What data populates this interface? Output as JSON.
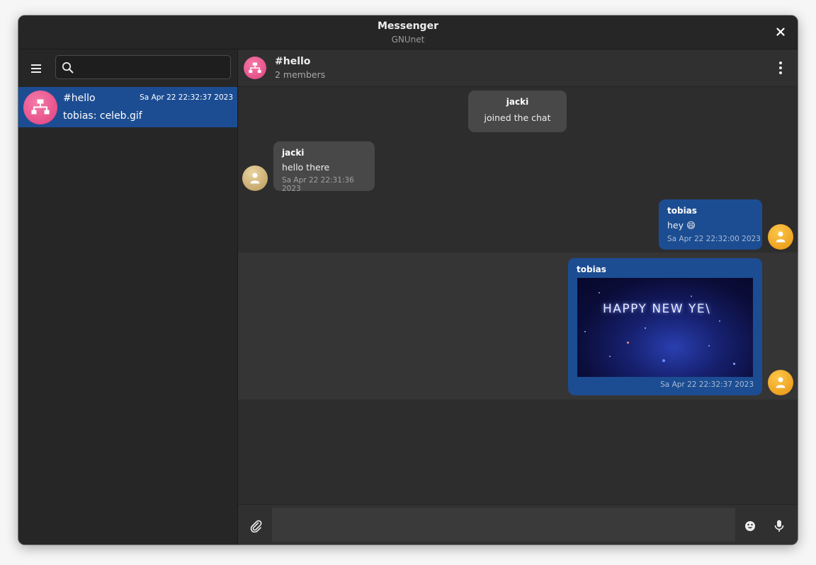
{
  "window": {
    "title": "Messenger",
    "subtitle": "GNUnet"
  },
  "sidebar": {
    "search": {
      "placeholder": "",
      "value": ""
    },
    "chats": [
      {
        "name": "#hello",
        "time": "Sa Apr 22 22:32:37 2023",
        "preview": "tobias: celeb.gif",
        "icon": "group-network-icon"
      }
    ]
  },
  "chat": {
    "title": "#hello",
    "subtitle": "2 members",
    "messages": [
      {
        "type": "event",
        "sender": "jacki",
        "text": "joined the chat"
      },
      {
        "type": "incoming",
        "sender": "jacki",
        "text": "hello there",
        "time": "Sa Apr 22 22:31:36 2023"
      },
      {
        "type": "outgoing",
        "sender": "tobias",
        "text": "hey 😄",
        "time": "Sa Apr 22 22:32:00 2023"
      },
      {
        "type": "outgoing-image",
        "sender": "tobias",
        "image_text": "HAPPY NEW YE\\",
        "time": "Sa Apr 22 22:32:37 2023"
      }
    ]
  },
  "composer": {
    "placeholder": "",
    "value": ""
  },
  "colors": {
    "accent": "#1c4d92",
    "background": "#2d2d2d",
    "group_avatar": "#e0407e",
    "user_avatar_jacki": "#b9985a",
    "user_avatar_tobias": "#e8920f"
  }
}
